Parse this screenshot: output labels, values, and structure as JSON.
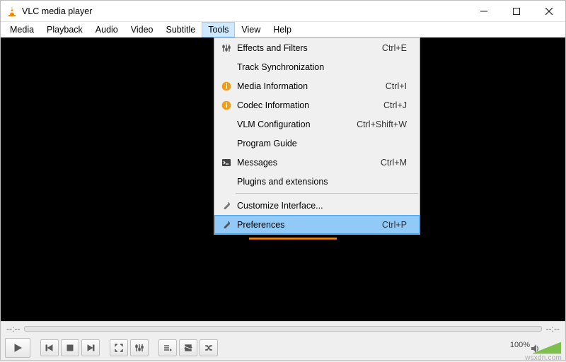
{
  "window": {
    "title": "VLC media player",
    "icon": "vlc-cone-icon"
  },
  "window_controls": {
    "minimize": "—",
    "maximize": "▢",
    "close": "✕"
  },
  "menubar": {
    "items": [
      {
        "label": "Media"
      },
      {
        "label": "Playback"
      },
      {
        "label": "Audio"
      },
      {
        "label": "Video"
      },
      {
        "label": "Subtitle"
      },
      {
        "label": "Tools",
        "open": true
      },
      {
        "label": "View"
      },
      {
        "label": "Help"
      }
    ]
  },
  "tools_menu": {
    "items": [
      {
        "icon": "sliders-icon",
        "label": "Effects and Filters",
        "shortcut": "Ctrl+E"
      },
      {
        "icon": "",
        "label": "Track Synchronization",
        "shortcut": ""
      },
      {
        "icon": "info-icon",
        "label": "Media Information",
        "shortcut": "Ctrl+I"
      },
      {
        "icon": "info-icon",
        "label": "Codec Information",
        "shortcut": "Ctrl+J"
      },
      {
        "icon": "",
        "label": "VLM Configuration",
        "shortcut": "Ctrl+Shift+W"
      },
      {
        "icon": "",
        "label": "Program Guide",
        "shortcut": ""
      },
      {
        "icon": "terminal-icon",
        "label": "Messages",
        "shortcut": "Ctrl+M"
      },
      {
        "icon": "",
        "label": "Plugins and extensions",
        "shortcut": ""
      },
      {
        "sep": true
      },
      {
        "icon": "wrench-icon",
        "label": "Customize Interface...",
        "shortcut": ""
      },
      {
        "icon": "wrench-icon",
        "label": "Preferences",
        "shortcut": "Ctrl+P",
        "highlighted": true
      }
    ]
  },
  "time": {
    "elapsed": "--:--",
    "remaining": "--:--"
  },
  "volume": {
    "percent_label": "100%"
  },
  "watermark": "wsxdn.com"
}
